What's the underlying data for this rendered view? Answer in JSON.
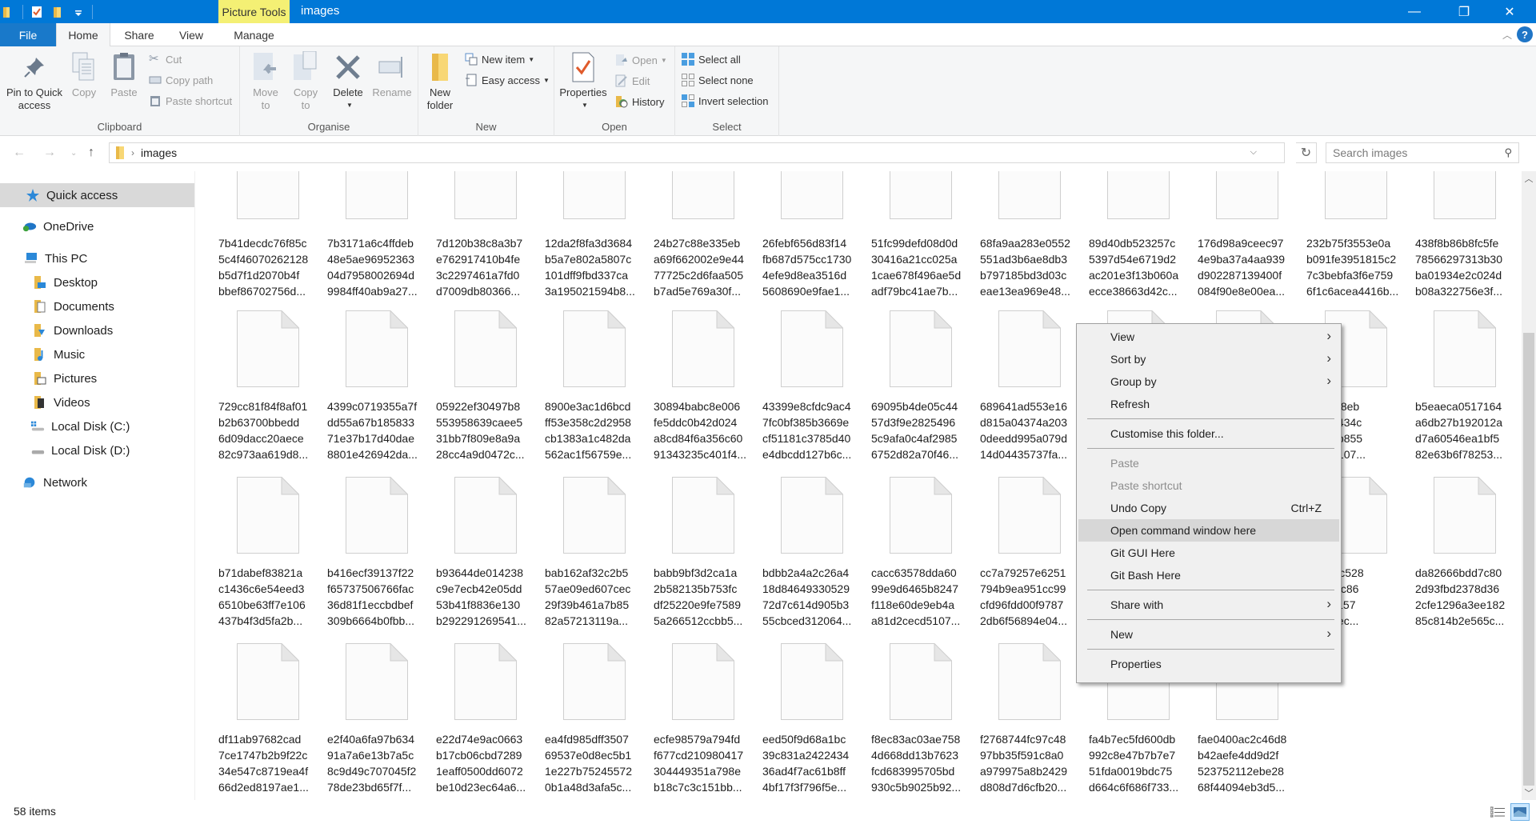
{
  "window": {
    "title": "images",
    "context_tab_header": "Picture Tools",
    "controls": {
      "minimize": "—",
      "maximize": "❐",
      "close": "✕"
    }
  },
  "ribbon_tabs": [
    {
      "label": "File"
    },
    {
      "label": "Home",
      "active": true
    },
    {
      "label": "Share"
    },
    {
      "label": "View"
    },
    {
      "label": "Manage"
    }
  ],
  "ribbon": {
    "clipboard": {
      "label": "Clipboard",
      "pin": "Pin to Quick access",
      "pin_l1": "Pin to Quick",
      "pin_l2": "access",
      "copy": "Copy",
      "paste": "Paste",
      "cut": "Cut",
      "copy_path": "Copy path",
      "paste_shortcut": "Paste shortcut"
    },
    "organise": {
      "label": "Organise",
      "move_to_l1": "Move",
      "move_to_l2": "to",
      "copy_to_l1": "Copy",
      "copy_to_l2": "to",
      "delete": "Delete",
      "rename": "Rename"
    },
    "new": {
      "label": "New",
      "new_folder_l1": "New",
      "new_folder_l2": "folder",
      "new_item": "New item",
      "easy_access": "Easy access"
    },
    "open": {
      "label": "Open",
      "properties": "Properties",
      "open": "Open",
      "edit": "Edit",
      "history": "History"
    },
    "select": {
      "label": "Select",
      "select_all": "Select all",
      "select_none": "Select none",
      "invert_selection": "Invert selection"
    }
  },
  "address": {
    "path": [
      "images"
    ],
    "search_placeholder": "Search images"
  },
  "nav_pane": [
    {
      "label": "Quick access",
      "icon": "star-icon",
      "selected": true,
      "indent": 0
    },
    {
      "label": "OneDrive",
      "icon": "onedrive-icon",
      "indent": 0
    },
    {
      "label": "This PC",
      "icon": "computer-icon",
      "indent": 0
    },
    {
      "label": "Desktop",
      "icon": "desktop-folder-icon",
      "indent": 1
    },
    {
      "label": "Documents",
      "icon": "documents-folder-icon",
      "indent": 1
    },
    {
      "label": "Downloads",
      "icon": "downloads-folder-icon",
      "indent": 1
    },
    {
      "label": "Music",
      "icon": "music-folder-icon",
      "indent": 1
    },
    {
      "label": "Pictures",
      "icon": "pictures-folder-icon",
      "indent": 1
    },
    {
      "label": "Videos",
      "icon": "videos-folder-icon",
      "indent": 1
    },
    {
      "label": "Local Disk (C:)",
      "icon": "drive-c-icon",
      "indent": 1
    },
    {
      "label": "Local Disk (D:)",
      "icon": "drive-d-icon",
      "indent": 1
    },
    {
      "label": "Network",
      "icon": "network-icon",
      "indent": 0
    }
  ],
  "files": {
    "rows": [
      [
        "7b41decdc76f85c\n5c4f46070262128\nb5d7f1d2070b4f\nbbef86702756d...",
        "7b3171a6c4ffdeb\n48e5ae96952363\n04d7958002694d\n9984ff40ab9a27...",
        "7d120b38c8a3b7\ne762917410b4fe\n3c2297461a7fd0\nd7009db80366...",
        "12da2f8fa3d3684\nb5a7e802a5807c\n101dff9fbd337ca\n3a195021594b8...",
        "24b27c88e335eb\na69f662002e9e44\n77725c2d6faa505\nb7ad5e769a30f...",
        "26febf656d83f14\nfb687d575cc1730\n4efe9d8ea3516d\n5608690e9fae1...",
        "51fc99defd08d0d\n30416a21cc025a\n1cae678f496ae5d\nadf79bc41ae7b...",
        "68fa9aa283e0552\n551ad3b6ae8db3\nb797185bd3d03c\neae13ea969e48...",
        "89d40db523257c\n5397d54e6719d2\nac201e3f13b060a\necce38663d42c...",
        "176d98a9ceec97\n4e9ba37a4aa939\nd902287139400f\n084f90e8e00ea...",
        "232b75f3553e0a\nb091fe3951815c2\n7c3bebfa3f6e759\n6f1c6acea4416b...",
        "438f8b86b8fc5fe\n78566297313b30\nba01934e2c024d\nb08a322756e3f..."
      ],
      [
        "729cc81f84f8af01\nb2b63700bbedd\n6d09dacc20aece\n82c973aa619d8...",
        "4399c0719355a7f\ndd55a67b185833\n71e37b17d40dae\n8801e426942da...",
        "05922ef30497b8\n553958639caee5\n31bb7f809e8a9a\n28cc4a9d0472c...",
        "8900e3ac1d6bcd\nff53e358c2d2958\ncb1383a1c482da\n562ac1f56759e...",
        "30894babc8e006\nfe5ddc0b42d024\na8cd84f6a356c60\n91343235c401f4...",
        "43399e8cfdc9ac4\n7fc0bf385b3669e\ncf51181c3785d40\ne4dbcdd127b6c...",
        "69095b4de05c44\n57d3f9e2825496\n5c9afa0c4af2985\n6752d82a70f46...",
        "689641ad553e16\nd815a04374a203\n0deedd995a079d\n14d04435737fa...",
        "",
        "",
        "553d9f8eb\n54a0a434c\n0ae2ab855\n7b5ba107...",
        "b5eaeca0517164\na6db27b192012a\nd7a60546ea1bf5\n82e63b6f78253..."
      ],
      [
        "b71dabef83821a\nc1436c6e54eed3\n6510be63ff7e106\n437b4f3d5fa2b...",
        "b416ecf39137f22\nf65737506766fac\n36d81f1eccbdbef\n309b6664b0fbb...",
        "b93644de014238\nc9e7ecb42e05dd\n53b41f8836e130\nb292291269541...",
        "bab162af32c2b5\n57ae09ed607cec\n29f39b461a7b85\n82a57213119a...",
        "babb9bf3d2ca1a\n2b582135b753fc\ndf25220e9fe7589\n5a266512ccbb5...",
        "bdbb2a4a2c26a4\n18d84649330529\n72d7c614d905b3\n55cbced312064...",
        "cacc63578dda60\n99e9d6465b8247\nf118e60de9eb4a\na81d2cecd5107...",
        "cc7a79257e6251\n794b9ea951cc99\ncfd96fdd00f9787\n2db6f56894e04...",
        "",
        "",
        "1caafcc528\n68f4b3c86\n4f1fec157\n4bb87ec...",
        "da82666bdd7c80\n2d93fbd2378d36\n2cfe1296a3ee182\n85c814b2e565c..."
      ],
      [
        "df11ab97682cad\n7ce1747b2b9f22c\n34e547c8719ea4f\n66d2ed8197ae1...",
        "e2f40a6fa97b634\n91a7a6e13b7a5c\n8c9d49c707045f2\n78de23bd65f7f...",
        "e22d74e9ac0663\nb17cb06cbd7289\n1eaff0500dd6072\nbe10d23ec64a6...",
        "ea4fd985dff3507\n69537e0d8ec5b1\n1e227b75245572\n0b1a48d3afa5c...",
        "ecfe98579a794fd\nf677cd210980417\n304449351a798e\nb18c7c3c151bb...",
        "eed50f9d68a1bc\n39c831a2422434\n36ad4f7ac61b8ff\n4bf17f3f796f5e...",
        "f8ec83ac03ae758\n4d668dd13b7623\nfcd683995705bd\n930c5b9025b92...",
        "f2768744fc97c48\n97bb35f591c8a0\na979975a8b2429\nd808d7d6cfb20...",
        "fa4b7ec5fd600db\n992c8e47b7b7e7\n51fda0019bdc75\nd664c6f686f733...",
        "fae0400ac2c46d8\nb42aefe4dd9d2f\n523752112ebe28\n68f44094eb3d5..."
      ]
    ]
  },
  "context_menu": {
    "items": [
      {
        "type": "item",
        "label": "View",
        "submenu": true
      },
      {
        "type": "item",
        "label": "Sort by",
        "submenu": true
      },
      {
        "type": "item",
        "label": "Group by",
        "submenu": true
      },
      {
        "type": "item",
        "label": "Refresh"
      },
      {
        "type": "separator"
      },
      {
        "type": "item",
        "label": "Customise this folder..."
      },
      {
        "type": "separator"
      },
      {
        "type": "item",
        "label": "Paste",
        "disabled": true
      },
      {
        "type": "item",
        "label": "Paste shortcut",
        "disabled": true
      },
      {
        "type": "item",
        "label": "Undo Copy",
        "shortcut": "Ctrl+Z"
      },
      {
        "type": "item",
        "label": "Open command window here",
        "highlighted": true
      },
      {
        "type": "item",
        "label": "Git GUI Here"
      },
      {
        "type": "item",
        "label": "Git Bash Here"
      },
      {
        "type": "separator"
      },
      {
        "type": "item",
        "label": "Share with",
        "submenu": true
      },
      {
        "type": "separator"
      },
      {
        "type": "item",
        "label": "New",
        "submenu": true
      },
      {
        "type": "separator"
      },
      {
        "type": "item",
        "label": "Properties"
      }
    ]
  },
  "status": {
    "item_count": "58 items"
  },
  "colors": {
    "titlebar": "#0078d7",
    "picture_tools": "#f4f074",
    "file_tab": "#1979ca",
    "selection": "#d9d9d9"
  }
}
